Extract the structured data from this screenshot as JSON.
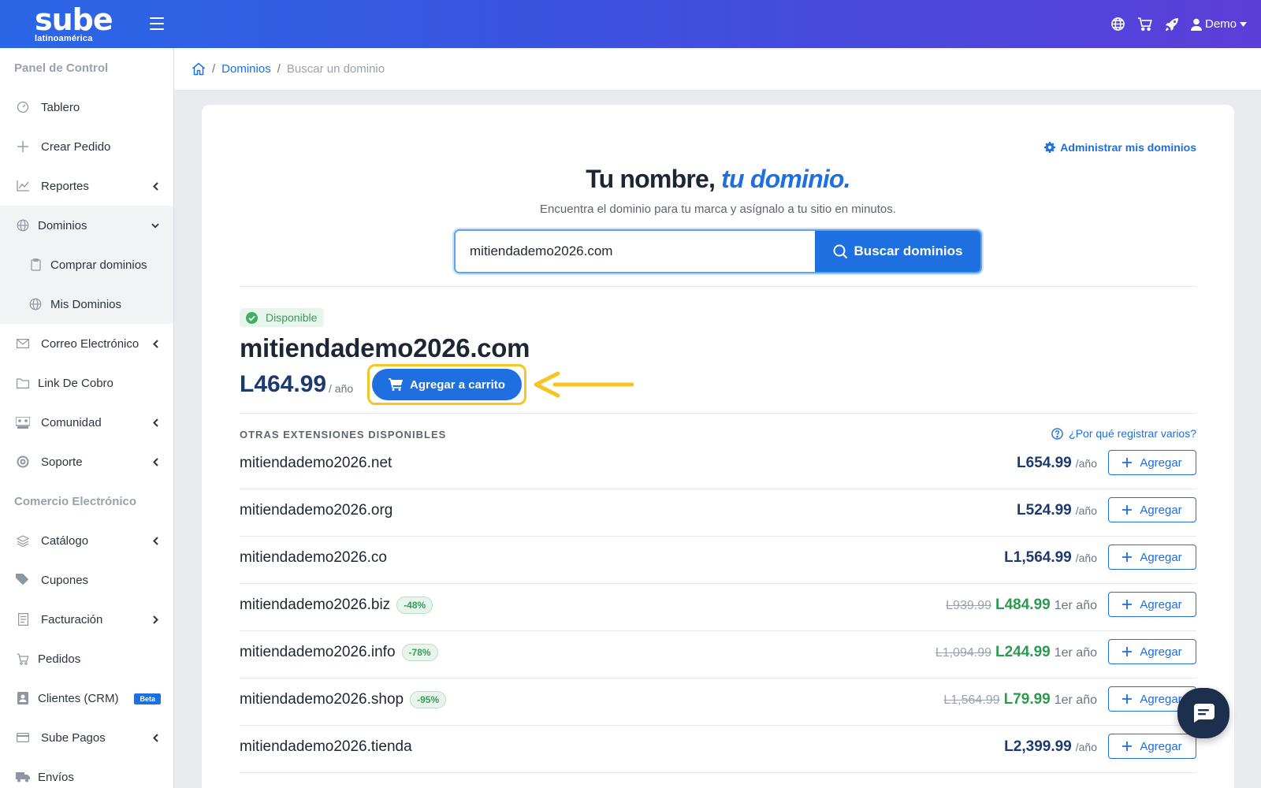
{
  "header": {
    "logo_main": "sube",
    "logo_sub": "latinoamérica",
    "user_label": "Demo"
  },
  "sidebar": {
    "section1": "Panel de Control",
    "section2": "Comercio Electrónico",
    "items": {
      "tablero": "Tablero",
      "crear_pedido": "Crear Pedido",
      "reportes": "Reportes",
      "dominios": "Dominios",
      "comprar_dominios": "Comprar dominios",
      "mis_dominios": "Mis Dominios",
      "correo": "Correo Electrónico",
      "link_cobro": "Link De Cobro",
      "comunidad": "Comunidad",
      "soporte": "Soporte",
      "catalogo": "Catálogo",
      "cupones": "Cupones",
      "facturacion": "Facturación",
      "pedidos": "Pedidos",
      "clientes": "Clientes (CRM)",
      "clientes_badge": "Beta",
      "sube_pagos": "Sube Pagos",
      "envios": "Envíos"
    }
  },
  "breadcrumb": {
    "dominios": "Dominios",
    "current": "Buscar un dominio"
  },
  "main": {
    "manage_link": "Administrar mis dominios",
    "title_part1": "Tu nombre, ",
    "title_part2": "tu dominio.",
    "subtitle": "Encuentra el dominio para tu marca y asígnalo a tu sitio en minutos.",
    "search_value": "mitiendademo2026.com",
    "search_button": "Buscar dominios",
    "availability": "Disponible",
    "domain": "mitiendademo2026.com",
    "price": "L464.99",
    "price_unit": "/ año",
    "cart_button": "Agregar a carrito",
    "extensions_heading": "OTRAS EXTENSIONES DISPONIBLES",
    "why_link": "¿Por qué registrar varios?",
    "add_label": "Agregar"
  },
  "extensions": [
    {
      "name": "mitiendademo2026.net",
      "discount": "",
      "old_price": "",
      "price": "L654.99",
      "unit": "/año"
    },
    {
      "name": "mitiendademo2026.org",
      "discount": "",
      "old_price": "",
      "price": "L524.99",
      "unit": "/año"
    },
    {
      "name": "mitiendademo2026.co",
      "discount": "",
      "old_price": "",
      "price": "L1,564.99",
      "unit": "/año"
    },
    {
      "name": "mitiendademo2026.biz",
      "discount": "-48%",
      "old_price": "L939.99",
      "price": "L484.99",
      "unit": "1er año"
    },
    {
      "name": "mitiendademo2026.info",
      "discount": "-78%",
      "old_price": "L1,094.99",
      "price": "L244.99",
      "unit": "1er año"
    },
    {
      "name": "mitiendademo2026.shop",
      "discount": "-95%",
      "old_price": "L1,564.99",
      "price": "L79.99",
      "unit": "1er año"
    },
    {
      "name": "mitiendademo2026.tienda",
      "discount": "",
      "old_price": "",
      "price": "L2,399.99",
      "unit": "/año"
    }
  ],
  "colors": {
    "brand_blue": "#1e6fe0",
    "highlight_yellow": "#f3c623",
    "success_green": "#2c9a4f",
    "price_navy": "#1d3a6e"
  }
}
